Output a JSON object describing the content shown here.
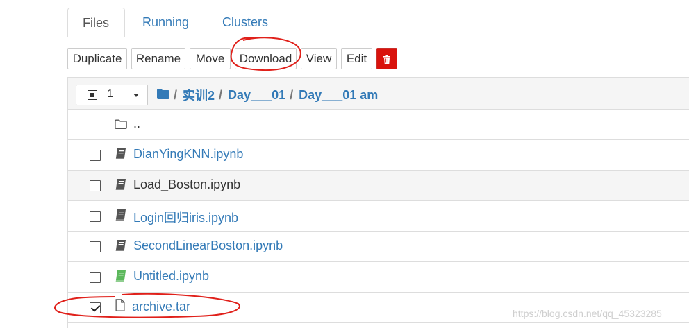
{
  "tabs": [
    {
      "label": "Files",
      "active": true
    },
    {
      "label": "Running",
      "active": false
    },
    {
      "label": "Clusters",
      "active": false
    }
  ],
  "toolbar": {
    "duplicate": "Duplicate",
    "rename": "Rename",
    "move": "Move",
    "download": "Download",
    "view": "View",
    "edit": "Edit",
    "delete_icon": "trash-icon"
  },
  "list_header": {
    "selected_count": "1",
    "breadcrumbs": [
      "实训2",
      "Day___01",
      "Day___01 am"
    ]
  },
  "items": [
    {
      "name": "..",
      "type": "parent-folder",
      "icon": "folder-icon",
      "checked": false
    },
    {
      "name": "DianYingKNN.ipynb",
      "type": "notebook",
      "icon": "notebook-icon",
      "checked": false
    },
    {
      "name": "Load_Boston.ipynb",
      "type": "notebook",
      "icon": "notebook-icon",
      "checked": false
    },
    {
      "name": "Login回归iris.ipynb",
      "type": "notebook",
      "icon": "notebook-icon",
      "checked": false
    },
    {
      "name": "SecondLinearBoston.ipynb",
      "type": "notebook",
      "icon": "notebook-icon",
      "checked": false
    },
    {
      "name": "Untitled.ipynb",
      "type": "notebook-running",
      "icon": "notebook-icon",
      "checked": false
    },
    {
      "name": "archive.tar",
      "type": "file",
      "icon": "file-icon",
      "checked": true
    }
  ],
  "colors": {
    "link": "#337ab7",
    "danger": "#d9120c",
    "running_notebook": "#5cb85c",
    "annotation": "#e0201a"
  },
  "watermark": "https://blog.csdn.net/qq_45323285"
}
